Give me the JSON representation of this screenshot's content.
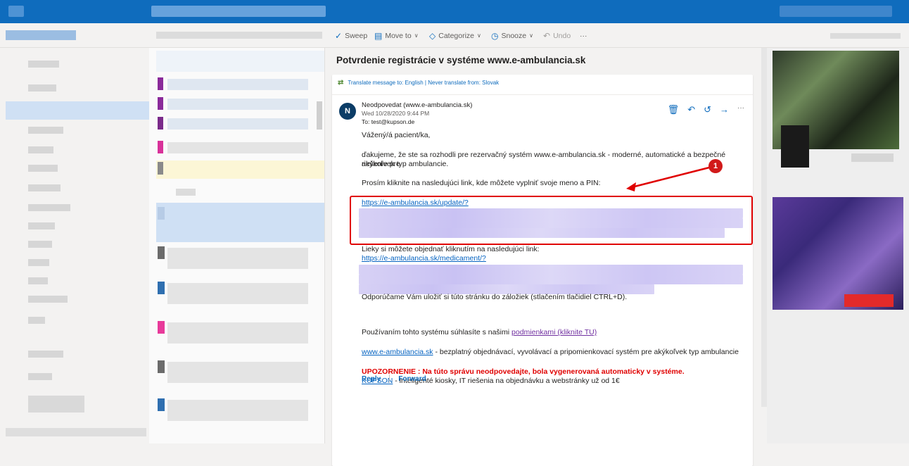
{
  "toolbar": {
    "sweep": "Sweep",
    "move_to": "Move to",
    "categorize": "Categorize",
    "snooze": "Snooze",
    "undo": "Undo",
    "more": "···"
  },
  "email": {
    "subject": "Potvrdenie registrácie v systéme www.e-ambulancia.sk",
    "translate_link": "Translate message to: English | Never translate from: Slovak",
    "avatar_initial": "N",
    "sender": "Neodpovedat (www.e-ambulancia.sk)",
    "date": "Wed 10/28/2020 9:44 PM",
    "to": "To:  test@kupson.de",
    "greeting": "Vážený/á pacient/ka,",
    "para1_line1": "ďakujeme, že ste sa rozhodli pre rezervačný systém www.e-ambulancia.sk - moderné, automatické a bezpečné riešenie pre",
    "para1_line2": "akýkoľvek typ ambulancie.",
    "para2": "Prosím kliknite na nasledujúci link, kde môžete vyplniť svoje meno a PIN:",
    "update_link": "https://e-ambulancia.sk/update/?",
    "para3": "Lieky si môžete objednať kliknutím na nasledujúci link:",
    "medicament_link": "https://e-ambulancia.sk/medicament/?",
    "para4": "Odporúčame Vám uložiť si túto stránku do záložiek (stlačením tlačidiel CTRL+D).",
    "terms_text": "Používaním tohto systému súhlasíte s našimi ",
    "terms_link": "podmienkami (kliknite TU)",
    "site_link": "www.e-ambulancia.sk",
    "site_desc": " - bezplatný objednávací, vyvolávací a pripomienkovací systém pre akýkoľvek typ ambulancie",
    "warning": "UPOZORNENIE : Na túto správu neodpovedajte, bola vygenerovaná automaticky v systéme.",
    "kupson_link": "KUPSON",
    "kupson_desc": " - inteligenté kiosky, IT riešenia na objednávku a webstránky už od 1€",
    "reply": "Reply",
    "forward": "Forward"
  },
  "annotation": {
    "badge": "1",
    "color": "#e00000"
  },
  "colors": {
    "accent": "#0f6cbd",
    "link": "#0563c1",
    "warning": "#e00000"
  }
}
